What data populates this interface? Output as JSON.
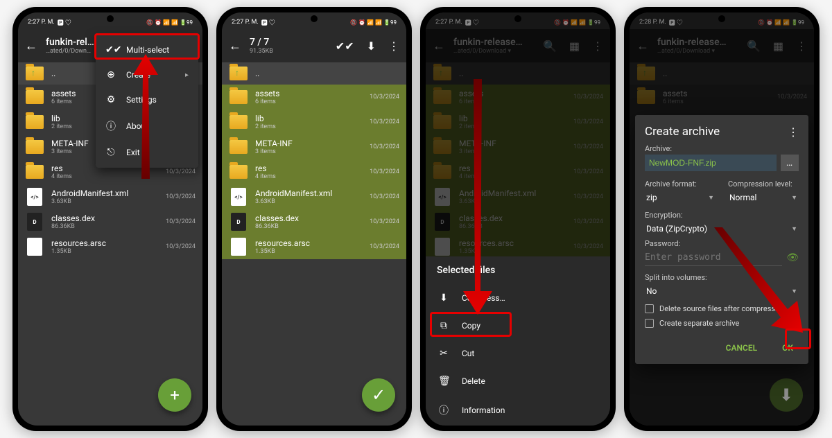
{
  "status": {
    "time1": "2:27 P. M.",
    "time2": "2:27 P. M.",
    "time3": "2:27 P. M.",
    "time4": "2:28 P. M.",
    "right": "📵 ⏰ 📶 📶 🔋99"
  },
  "screen1": {
    "title": "funkin-rel…",
    "subtitle": "…ated/0/Down…",
    "menu": {
      "multi": "Multi-select",
      "create": "Create",
      "settings": "Settings",
      "about": "About",
      "exit": "Exit"
    }
  },
  "screen2": {
    "title": "7 / 7",
    "subtitle": "91.35KB"
  },
  "screen3": {
    "title": "funkin-release…",
    "subtitle": "…ated/0/Download",
    "sheet_title": "Selected files",
    "compress": "Compress…",
    "copy": "Copy",
    "cut": "Cut",
    "delete": "Delete",
    "information": "Information"
  },
  "screen4": {
    "title": "funkin-release…",
    "subtitle": "…ated/0/Download",
    "dialog": {
      "title": "Create archive",
      "archive_label": "Archive:",
      "archive_name": "NewMOD-FNF.zip",
      "format_label": "Archive format:",
      "format_value": "zip",
      "level_label": "Compression level:",
      "level_value": "Normal",
      "encryption_label": "Encryption:",
      "encryption_value": "Data (ZipCrypto)",
      "password_label": "Password:",
      "password_placeholder": "Enter password",
      "split_label": "Split into volumes:",
      "split_value": "No",
      "delete_source": "Delete source files after compression",
      "separate": "Create separate archive",
      "cancel": "CANCEL",
      "ok": "OK"
    }
  },
  "files": {
    "dots": "..",
    "assets": {
      "name": "assets",
      "sub": "6 items",
      "date": "10/3/2024"
    },
    "lib": {
      "name": "lib",
      "sub": "2 items",
      "date": "10/3/2024"
    },
    "meta": {
      "name": "META-INF",
      "sub": "3 items",
      "date": "10/3/2024"
    },
    "res": {
      "name": "res",
      "sub": "4 items",
      "date": "10/3/2024"
    },
    "manifest": {
      "name": "AndroidManifest.xml",
      "sub": "3.63KB",
      "date": "10/3/2024"
    },
    "classes": {
      "name": "classes.dex",
      "sub": "86.36KB",
      "date": "10/3/2024"
    },
    "resources": {
      "name": "resources.arsc",
      "sub": "1.35KB",
      "date": "10/3/2024"
    }
  }
}
